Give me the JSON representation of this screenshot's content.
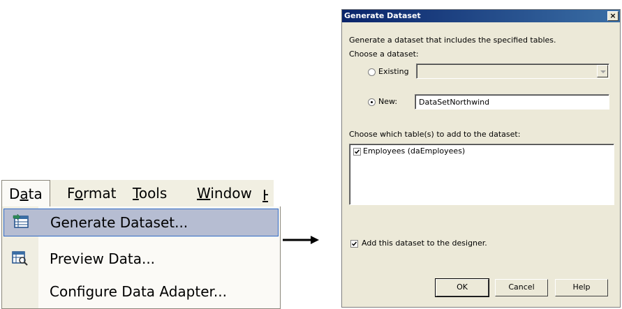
{
  "menu": {
    "menubar_items": [
      "Data",
      "Format",
      "Tools",
      "Window"
    ],
    "items": [
      {
        "label": "Generate Dataset...",
        "icon": "generate-dataset-icon",
        "highlighted": true
      },
      {
        "label": "Preview Data...",
        "icon": "preview-data-icon",
        "highlighted": false
      },
      {
        "label": "Configure Data Adapter...",
        "icon": "",
        "highlighted": false
      }
    ]
  },
  "dialog": {
    "title": "Generate Dataset",
    "close_glyph": "×",
    "intro": "Generate a dataset that includes the specified tables.",
    "choose_label": "Choose a dataset:",
    "existing_label": "Existing",
    "new_label": "New:",
    "new_value": "DataSetNorthwind",
    "tables_label": "Choose which table(s) to add to the dataset:",
    "tables": [
      "Employees (daEmployees)"
    ],
    "add_label": "Add this dataset to the designer.",
    "ok_label": "OK",
    "cancel_label": "Cancel",
    "help_label": "Help"
  },
  "colors": {
    "highlight_bg": "#b6bdd2",
    "highlight_border": "#316ac5",
    "dialog_bg": "#ece9d8",
    "title_bg": "#0a246a"
  }
}
